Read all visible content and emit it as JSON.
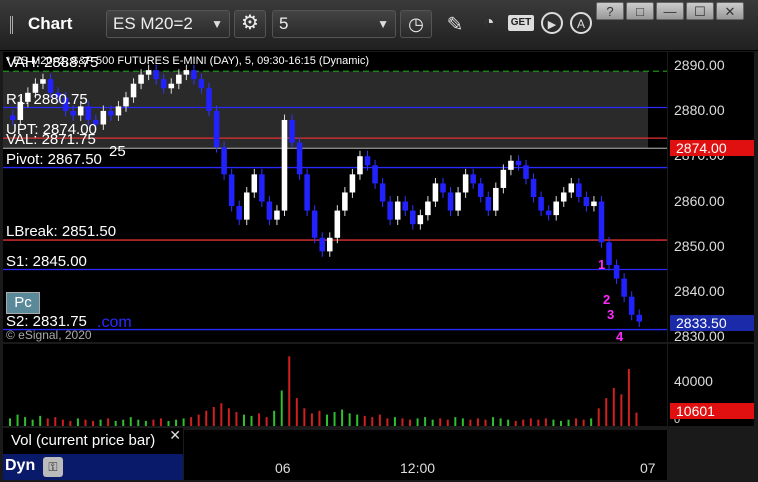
{
  "toolbar": {
    "app_label": "Chart",
    "symbol": "ES M20=2",
    "interval": "5",
    "get_label": "GET"
  },
  "window_controls": [
    "?",
    "□",
    "—",
    "☐",
    "✕"
  ],
  "chart": {
    "header": "* ES M20=2, S&P 500 FUTURES E-MINI (DAY), 5, 09:30-16:15 (Dynamic)",
    "copyright": "© eSignal, 2020",
    "levels": [
      {
        "label": "VAH: 2888.75",
        "price": 2888.75,
        "color": "#1a8f1a",
        "style": "dash"
      },
      {
        "label": "R1: 2880.75",
        "price": 2880.75,
        "color": "#2a2aff",
        "style": "solid"
      },
      {
        "label": "UPT: 2874.00",
        "price": 2874.0,
        "color": "#e23030",
        "style": "solid"
      },
      {
        "label": "VAL: 2871.75",
        "price": 2871.75,
        "color": "#888888",
        "style": "solid"
      },
      {
        "label": "Pivot: 2867.50",
        "price": 2867.5,
        "color": "#2a2aff",
        "style": "solid"
      },
      {
        "label": "LBreak: 2851.50",
        "price": 2851.5,
        "color": "#e23030",
        "style": "solid"
      },
      {
        "label": "S1: 2845.00",
        "price": 2845.0,
        "color": "#2a2aff",
        "style": "solid"
      },
      {
        "label": "S2: 2831.75",
        "price": 2831.75,
        "color": "#2a2aff",
        "style": "solid"
      }
    ],
    "val_suffix": "25",
    "pc_label": "Pc",
    "s2_suffix": ".com",
    "price_ticks": [
      "2890.00",
      "2880.00",
      "2870.00",
      "2860.00",
      "2850.00",
      "2840.00",
      "2830.00"
    ],
    "tick_values": [
      2890,
      2880,
      2870,
      2860,
      2850,
      2840,
      2830
    ],
    "upt_tag": "2874.00",
    "last_tag": "2833.50",
    "x_ticks": [
      "06",
      "12:00",
      "07"
    ],
    "sequence_labels": [
      "1",
      "2",
      "3",
      "4"
    ],
    "colors": {
      "up": "#ffffff",
      "down": "#2222ff",
      "resistance": "#e23030",
      "support": "#2a2aff",
      "value_area": "#1a8f1a"
    }
  },
  "chart_data": {
    "type": "candlestick",
    "title": "* ES M20=2, S&P 500 FUTURES E-MINI (DAY), 5, 09:30-16:15 (Dynamic)",
    "ylim": [
      2829,
      2893
    ],
    "close": [
      2878,
      2882,
      2884,
      2886,
      2887,
      2884,
      2883,
      2880,
      2879,
      2881,
      2878,
      2877,
      2880,
      2879,
      2881,
      2883,
      2886,
      2888,
      2889,
      2887,
      2885,
      2886,
      2888,
      2889,
      2887,
      2885,
      2880,
      2872,
      2866,
      2859,
      2856,
      2862,
      2866,
      2860,
      2856,
      2858,
      2878,
      2873,
      2866,
      2858,
      2852,
      2849,
      2852,
      2858,
      2862,
      2866,
      2870,
      2868,
      2864,
      2860,
      2856,
      2860,
      2858,
      2855,
      2857,
      2860,
      2864,
      2862,
      2858,
      2862,
      2866,
      2864,
      2861,
      2858,
      2863,
      2867,
      2869,
      2868,
      2865,
      2861,
      2858,
      2857,
      2860,
      2862,
      2864,
      2861,
      2859,
      2860,
      2851,
      2846,
      2843,
      2839,
      2835,
      2833.5
    ],
    "volume_ticks": [
      "40000",
      "0"
    ],
    "volume_values": [
      6000,
      9000,
      7000,
      5000,
      8000,
      6000,
      7000,
      5000,
      4000,
      6000,
      5000,
      4000,
      5000,
      6000,
      4000,
      5000,
      7000,
      5000,
      4000,
      5000,
      6000,
      4000,
      5000,
      6000,
      7000,
      9000,
      12000,
      15000,
      18000,
      14000,
      11000,
      9000,
      8000,
      10000,
      7000,
      12000,
      28000,
      55000,
      22000,
      14000,
      10000,
      12000,
      9000,
      11000,
      13000,
      10000,
      9000,
      8000,
      7000,
      9000,
      6000,
      7000,
      6000,
      5000,
      6000,
      7000,
      5000,
      6000,
      5000,
      7000,
      6000,
      5000,
      6000,
      5000,
      7000,
      6000,
      5000,
      4000,
      5000,
      6000,
      5000,
      6000,
      5000,
      4000,
      5000,
      6000,
      5000,
      6000,
      14000,
      22000,
      30000,
      25000,
      45000,
      10601
    ],
    "last_volume": 10601,
    "last_price": 2833.5
  },
  "volume": {
    "label": "Vol (current price bar)",
    "tag": "10601",
    "close_x": "x"
  },
  "footer": {
    "dyn_label": "Dyn"
  }
}
